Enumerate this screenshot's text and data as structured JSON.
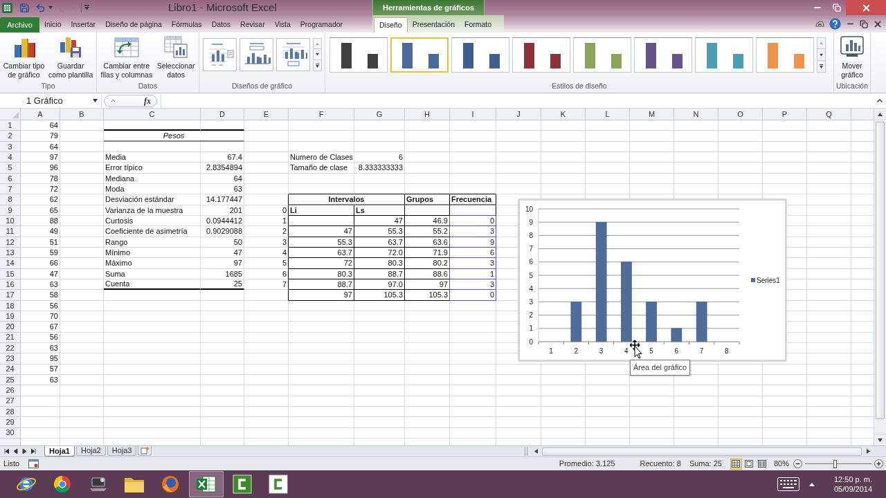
{
  "window": {
    "title": "Libro1 - Microsoft Excel",
    "context_label": "Herramientas de gráficos"
  },
  "ribbon_tabs": [
    {
      "label": "Archivo",
      "kind": "file",
      "selected": false
    },
    {
      "label": "Inicio",
      "kind": "tab",
      "selected": false
    },
    {
      "label": "Insertar",
      "kind": "tab",
      "selected": false
    },
    {
      "label": "Diseño de página",
      "kind": "tab",
      "selected": false
    },
    {
      "label": "Fórmulas",
      "kind": "tab",
      "selected": false
    },
    {
      "label": "Datos",
      "kind": "tab",
      "selected": false
    },
    {
      "label": "Revisar",
      "kind": "tab",
      "selected": false
    },
    {
      "label": "Vista",
      "kind": "tab",
      "selected": false
    },
    {
      "label": "Programador",
      "kind": "tab",
      "selected": false
    },
    {
      "label": "Diseño",
      "kind": "context",
      "selected": true
    },
    {
      "label": "Presentación",
      "kind": "context",
      "selected": false
    },
    {
      "label": "Formato",
      "kind": "context",
      "selected": false
    }
  ],
  "ribbon_groups": [
    {
      "label": "Tipo",
      "kind": "buttons",
      "buttons": [
        {
          "lines": [
            "Cambiar tipo",
            "de gráfico"
          ]
        },
        {
          "lines": [
            "Guardar",
            "como plantilla"
          ]
        }
      ]
    },
    {
      "label": "Datos",
      "kind": "buttons",
      "buttons": [
        {
          "lines": [
            "Cambiar entre",
            "filas y columnas"
          ]
        },
        {
          "lines": [
            "Seleccionar",
            "datos"
          ]
        }
      ]
    },
    {
      "label": "Diseños de gráfico",
      "kind": "layouts",
      "layouts": [
        {
          "selected": false
        },
        {
          "selected": false
        },
        {
          "selected": false
        }
      ]
    },
    {
      "label": "Estilos de diseño",
      "kind": "styles",
      "styles": [
        {
          "color": "#404040",
          "selected": false
        },
        {
          "color": "#4a6a9c",
          "selected": true
        },
        {
          "color": "#3e5f92",
          "selected": false
        },
        {
          "color": "#8c3339",
          "selected": false
        },
        {
          "color": "#8aa55a",
          "selected": false
        },
        {
          "color": "#64548a",
          "selected": false
        },
        {
          "color": "#4a9fb0",
          "selected": false
        },
        {
          "color": "#f0944a",
          "selected": false
        }
      ]
    },
    {
      "label": "Ubicación",
      "kind": "buttons",
      "buttons": [
        {
          "lines": [
            "Mover",
            "gráfico"
          ]
        }
      ]
    }
  ],
  "formula_bar": {
    "name_box": "1 Gráfico",
    "function_button": "fx"
  },
  "sheet": {
    "columns": [
      "A",
      "B",
      "C",
      "D",
      "E",
      "F",
      "G",
      "H",
      "I",
      "J",
      "K",
      "L",
      "M",
      "N",
      "O",
      "P",
      "Q"
    ],
    "row_numbers": [
      "1",
      "2",
      "3",
      "4",
      "5",
      "6",
      "7",
      "8",
      "9",
      "10",
      "11",
      "12",
      "13",
      "14",
      "15",
      "16",
      "17",
      "18",
      "19",
      "20",
      "21",
      "22",
      "23",
      "24",
      "25",
      "26",
      "27",
      "28",
      "29",
      "30"
    ],
    "column_a": [
      "64",
      "79",
      "64",
      "97",
      "96",
      "78",
      "72",
      "62",
      "65",
      "88",
      "49",
      "51",
      "59",
      "66",
      "47",
      "63",
      "58",
      "56",
      "70",
      "67",
      "56",
      "63",
      "95",
      "57",
      "63"
    ],
    "stats": {
      "title": "Pesos",
      "rows": [
        {
          "label": "Media",
          "value": "67.4"
        },
        {
          "label": "Error típico",
          "value": "2.8354894"
        },
        {
          "label": "Mediana",
          "value": "64"
        },
        {
          "label": "Moda",
          "value": "63"
        },
        {
          "label": "Desviación estándar",
          "value": "14.177447"
        },
        {
          "label": "Varianza de la muestra",
          "value": "201"
        },
        {
          "label": "Curtosis",
          "value": "0.0944412"
        },
        {
          "label": "Coeficiente de asimetría",
          "value": "0.9029088"
        },
        {
          "label": "Rango",
          "value": "50"
        },
        {
          "label": "Mínimo",
          "value": "47"
        },
        {
          "label": "Máximo",
          "value": "97"
        },
        {
          "label": "Suma",
          "value": "1685"
        },
        {
          "label": "Cuenta",
          "value": "25"
        }
      ]
    },
    "class_info": [
      {
        "label": "Numero de Clases",
        "value": "6"
      },
      {
        "label": "Tamaño de clase",
        "value": "8.333333333"
      }
    ],
    "frequency_table": {
      "headers": [
        "Intervalos",
        "Grupos",
        "Frecuencia"
      ],
      "subheader": {
        "index": "0",
        "li": "Li",
        "ls": "Ls"
      },
      "source_highlighted": true,
      "rows": [
        {
          "index": "1",
          "ls": "47",
          "group": "46.9",
          "freq": "0"
        },
        {
          "index": "2",
          "li": "47",
          "ls": "55.3",
          "group": "55.2",
          "freq": "3"
        },
        {
          "index": "3",
          "li": "55.3",
          "ls": "63.7",
          "group": "63.6",
          "freq": "9"
        },
        {
          "index": "4",
          "li": "63.7",
          "ls": "72.0",
          "group": "71.9",
          "freq": "6"
        },
        {
          "index": "5",
          "li": "72",
          "ls": "80.3",
          "group": "80.2",
          "freq": "3"
        },
        {
          "index": "6",
          "li": "80.3",
          "ls": "88.7",
          "group": "88.6",
          "freq": "1"
        },
        {
          "index": "7",
          "li": "88.7",
          "ls": "97.0",
          "group": "97",
          "freq": "3"
        },
        {
          "li": "97",
          "ls": "105.3",
          "group": "105.3",
          "freq": "0"
        }
      ]
    }
  },
  "chart": {
    "tooltip": "Área del gráfico",
    "chart_data": {
      "type": "bar",
      "grid": true,
      "categories": [
        "1",
        "2",
        "3",
        "4",
        "5",
        "6",
        "7",
        "8"
      ],
      "series": [
        {
          "name": "Series1",
          "color": "#4f6d9a",
          "values": [
            0,
            3,
            9,
            6,
            3,
            1,
            3,
            0
          ]
        }
      ],
      "ylim": [
        0,
        10
      ],
      "yticks": [
        0,
        1,
        2,
        3,
        4,
        5,
        6,
        7,
        8,
        9,
        10
      ]
    }
  },
  "sheet_tabs": [
    {
      "label": "Hoja1",
      "selected": true
    },
    {
      "label": "Hoja2",
      "selected": false
    },
    {
      "label": "Hoja3",
      "selected": false
    }
  ],
  "status_bar": {
    "mode": "Listo",
    "average": "Promedio: 3.125",
    "count": "Recuento: 8",
    "sum": "Suma: 25",
    "views": [
      {
        "selected": true
      },
      {
        "selected": false
      },
      {
        "selected": false
      }
    ],
    "zoom": "80%",
    "zoom_slider": {
      "level": 0.45
    }
  },
  "taskbar": {
    "apps": [
      {
        "selected": false
      },
      {
        "selected": false
      },
      {
        "selected": false
      },
      {
        "selected": false
      },
      {
        "selected": false
      },
      {
        "selected": true
      },
      {
        "selected": false
      },
      {
        "selected": false
      }
    ],
    "time": "12:50 p. m.",
    "date": "05/09/2014"
  }
}
